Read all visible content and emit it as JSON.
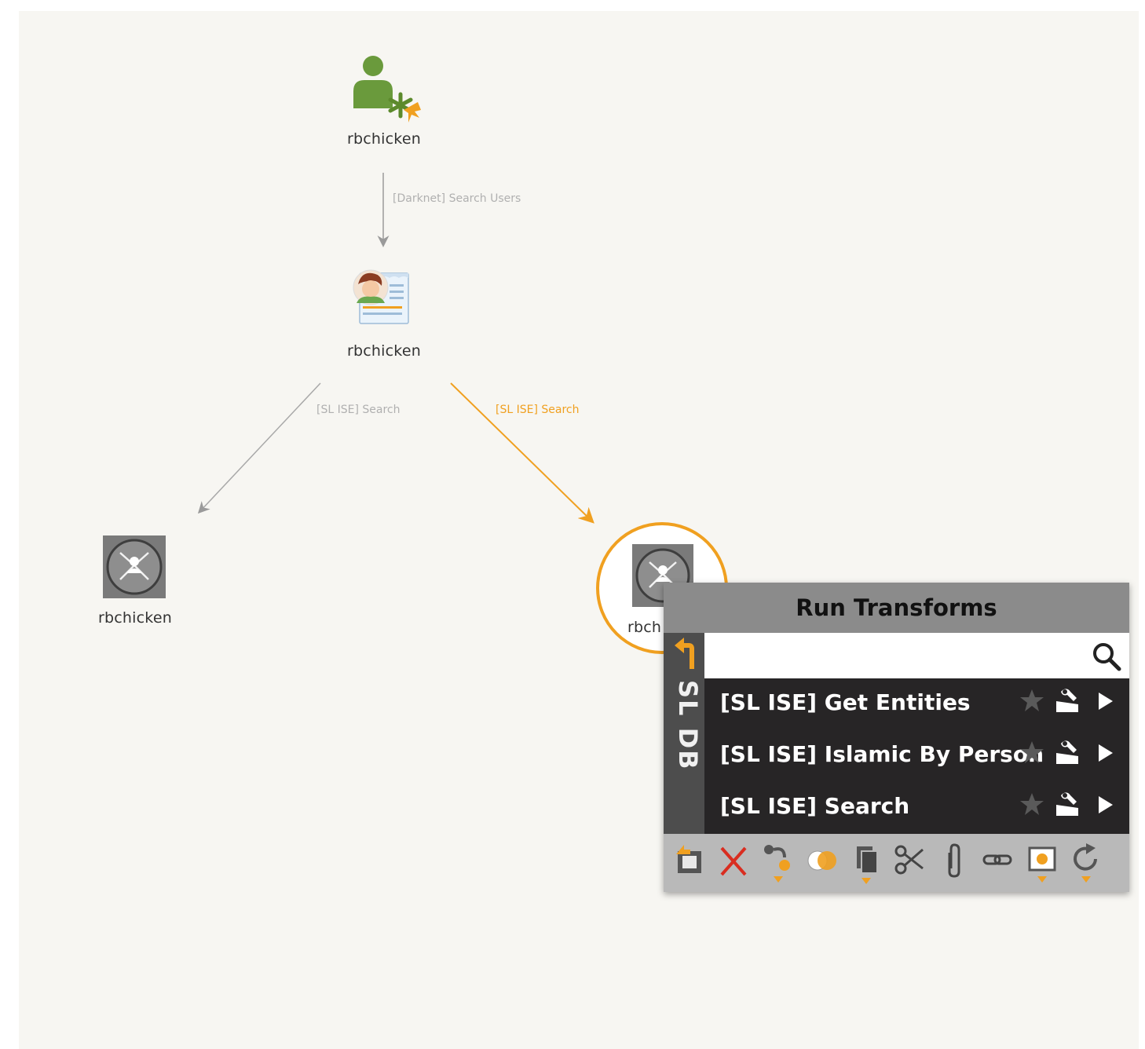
{
  "graph": {
    "nodes": [
      {
        "id": "user-node",
        "label": "rbchicken",
        "icon": "person-with-star-icon"
      },
      {
        "id": "profile-node",
        "label": "rbchicken",
        "icon": "profile-card-icon"
      },
      {
        "id": "alias-node-left",
        "label": "rbchicken",
        "icon": "social-alias-icon"
      },
      {
        "id": "alias-node-selected",
        "label": "rbch",
        "icon": "social-alias-icon"
      }
    ],
    "edges": [
      {
        "from": "user-node",
        "to": "profile-node",
        "label": "[Darknet] Search Users",
        "color": "#9a9a9a"
      },
      {
        "from": "profile-node",
        "to": "alias-node-left",
        "label": "[SL ISE] Search",
        "color": "#9a9a9a"
      },
      {
        "from": "profile-node",
        "to": "alias-node-selected",
        "label": "[SL ISE] Search",
        "color": "#f0a020"
      }
    ],
    "highlight_color": "#f0a020"
  },
  "popup": {
    "title": "Run Transforms",
    "side_tab": "SL DB",
    "search": {
      "value": "",
      "placeholder": ""
    },
    "transforms": [
      {
        "label": "[SL ISE] Get Entities"
      },
      {
        "label": "[SL ISE] Islamic By Person"
      },
      {
        "label": "[SL ISE] Search"
      }
    ],
    "toolbar": [
      "export-icon",
      "delete-icon",
      "select-connected-icon",
      "merge-icon",
      "copy-icon",
      "cut-icon",
      "attach-icon",
      "link-icon",
      "bookmark-icon",
      "refresh-icon"
    ]
  }
}
